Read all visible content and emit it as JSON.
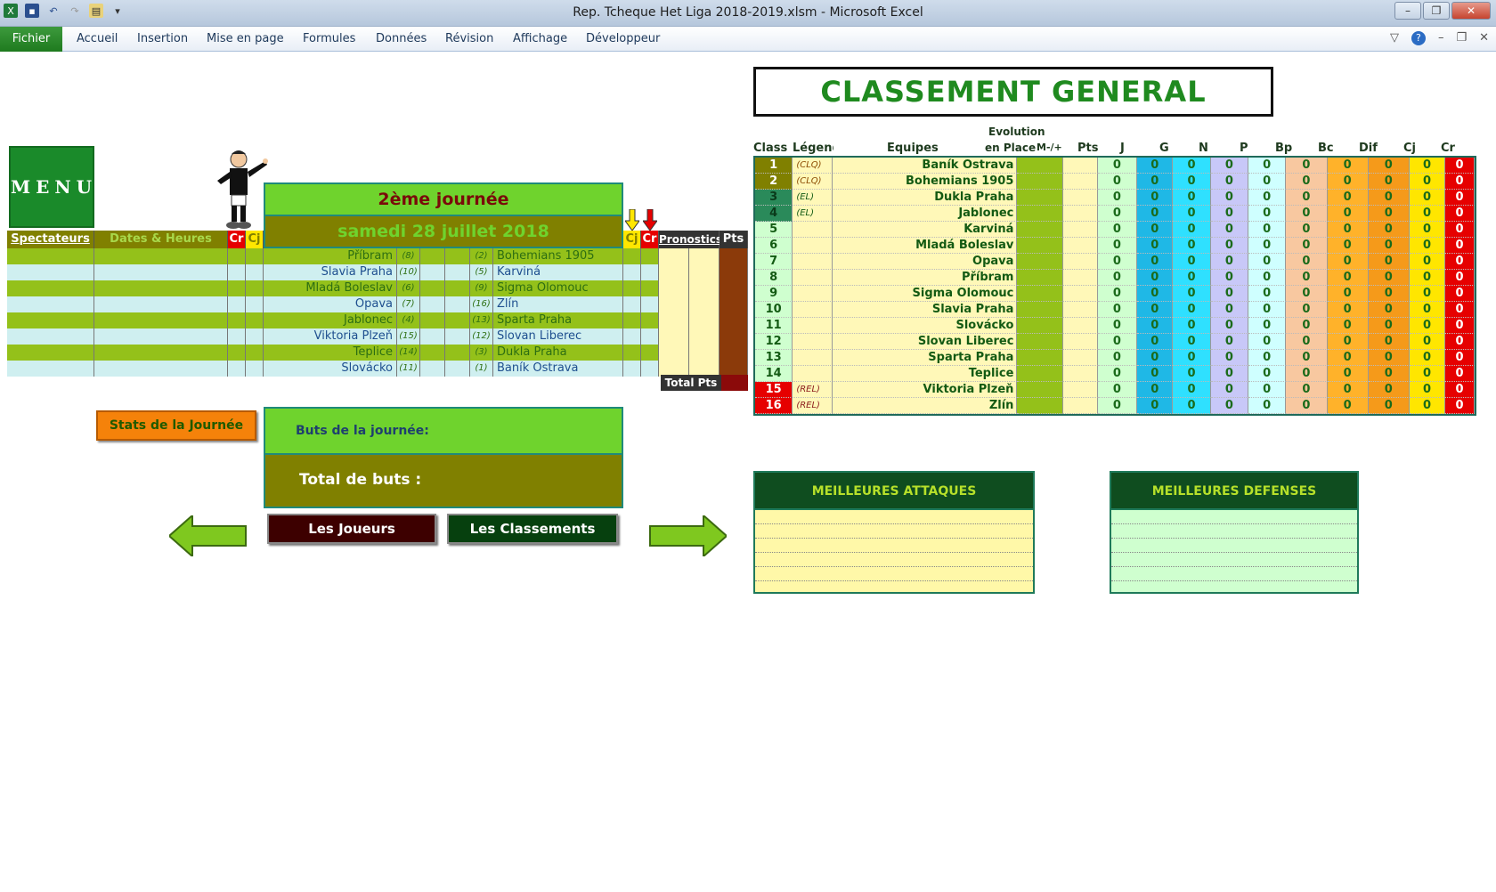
{
  "window": {
    "title": "Rep. Tcheque Het Liga 2018-2019.xlsm  -  Microsoft Excel"
  },
  "ribbon": {
    "file": "Fichier",
    "tabs": [
      "Accueil",
      "Insertion",
      "Mise en page",
      "Formules",
      "Données",
      "Révision",
      "Affichage",
      "Développeur"
    ]
  },
  "menu": {
    "label": "MENU"
  },
  "journee": {
    "title": "2ème journée",
    "date": "samedi 28 juillet 2018"
  },
  "match_header": {
    "spectateurs": "Spectateurs",
    "dates": "Dates & Heures",
    "cr": "Cr",
    "cj": "Cj",
    "cj2": "Cj",
    "cr2": "Cr",
    "pronostics": "Pronostics",
    "pts": "Pts"
  },
  "matches": [
    {
      "home": "Příbram",
      "hr": "(8)",
      "ar": "(2)",
      "away": "Bohemians 1905"
    },
    {
      "home": "Slavia Praha",
      "hr": "(10)",
      "ar": "(5)",
      "away": "Karviná"
    },
    {
      "home": "Mladá Boleslav",
      "hr": "(6)",
      "ar": "(9)",
      "away": "Sigma Olomouc"
    },
    {
      "home": "Opava",
      "hr": "(7)",
      "ar": "(16)",
      "away": "Zlín"
    },
    {
      "home": "Jablonec",
      "hr": "(4)",
      "ar": "(13)",
      "away": "Sparta Praha"
    },
    {
      "home": "Viktoria Plzeň",
      "hr": "(15)",
      "ar": "(12)",
      "away": "Slovan Liberec"
    },
    {
      "home": "Teplice",
      "hr": "(14)",
      "ar": "(3)",
      "away": "Dukla Praha"
    },
    {
      "home": "Slovácko",
      "hr": "(11)",
      "ar": "(1)",
      "away": "Baník Ostrava"
    }
  ],
  "total_pts": "Total Pts",
  "stats_button": "Stats de la Journée",
  "buts_label": "Buts de la journée:",
  "total_label": "Total de buts :",
  "btn_joueurs": "Les Joueurs",
  "btn_classements": "Les Classements",
  "classement": {
    "title": "CLASSEMENT GENERAL",
    "headers": {
      "class": "Class",
      "legende": "Légende",
      "equipes": "Equipes",
      "evolution": "Evolution",
      "enplace": "en Place",
      "mp": "M-/+",
      "pts": "Pts",
      "j": "J",
      "g": "G",
      "n": "N",
      "p": "P",
      "bp": "Bp",
      "bc": "Bc",
      "dif": "Dif",
      "cj": "Cj",
      "cr": "Cr"
    },
    "rows": [
      {
        "pos": "1",
        "leg": "(CLQ)",
        "team": "Baník Ostrava"
      },
      {
        "pos": "2",
        "leg": "(CLQ)",
        "team": "Bohemians 1905"
      },
      {
        "pos": "3",
        "leg": "(EL)",
        "team": "Dukla Praha"
      },
      {
        "pos": "4",
        "leg": "(EL)",
        "team": "Jablonec"
      },
      {
        "pos": "5",
        "leg": "",
        "team": "Karviná"
      },
      {
        "pos": "6",
        "leg": "",
        "team": "Mladá Boleslav"
      },
      {
        "pos": "7",
        "leg": "",
        "team": "Opava"
      },
      {
        "pos": "8",
        "leg": "",
        "team": "Příbram"
      },
      {
        "pos": "9",
        "leg": "",
        "team": "Sigma Olomouc"
      },
      {
        "pos": "10",
        "leg": "",
        "team": "Slavia Praha"
      },
      {
        "pos": "11",
        "leg": "",
        "team": "Slovácko"
      },
      {
        "pos": "12",
        "leg": "",
        "team": "Slovan Liberec"
      },
      {
        "pos": "13",
        "leg": "",
        "team": "Sparta Praha"
      },
      {
        "pos": "14",
        "leg": "",
        "team": "Teplice"
      },
      {
        "pos": "15",
        "leg": "(REL)",
        "team": "Viktoria Plzeň"
      },
      {
        "pos": "16",
        "leg": "(REL)",
        "team": "Zlín"
      }
    ],
    "zero": "0"
  },
  "attaques": "MEILLEURES ATTAQUES",
  "defenses": "MEILLEURES DEFENSES",
  "colors": {
    "green": "#94c11a",
    "olive": "#808000",
    "bright": "#6fd32d",
    "red": "#e60000",
    "cyan": "#cfeff0"
  }
}
